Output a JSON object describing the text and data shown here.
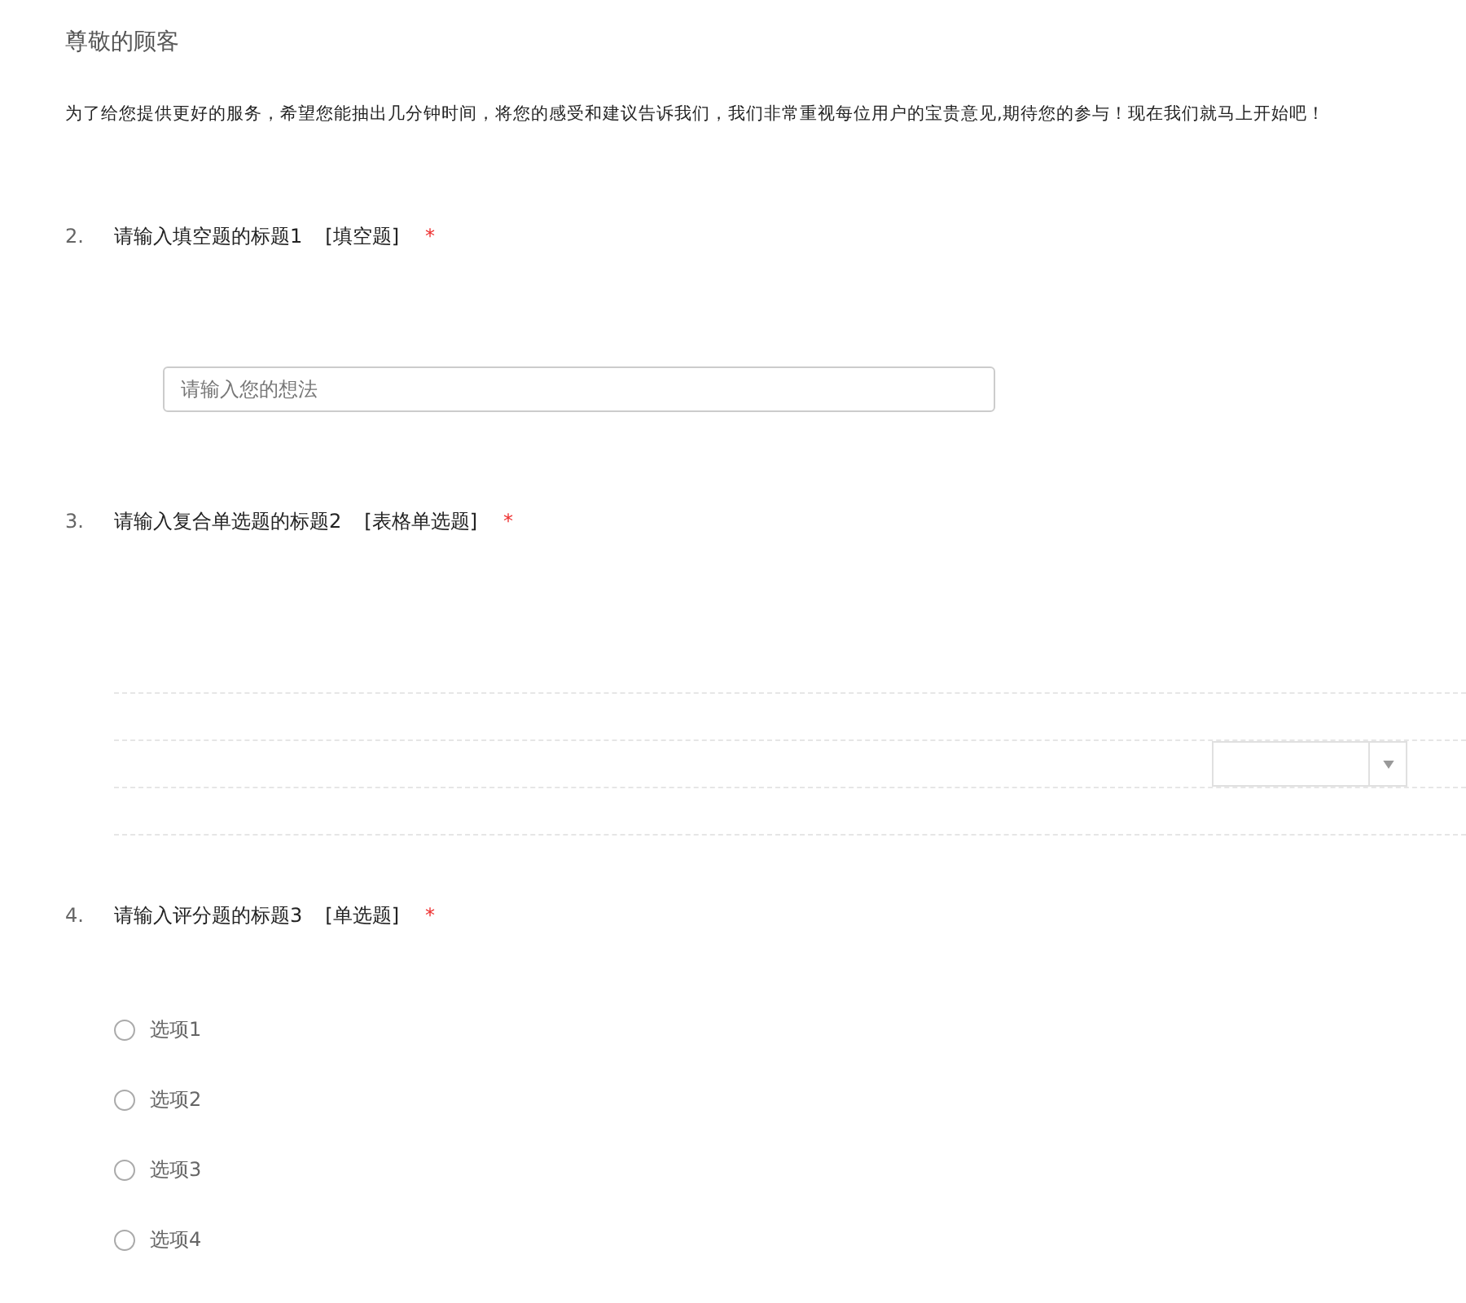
{
  "header": {
    "title": "尊敬的顾客",
    "intro": "为了给您提供更好的服务，希望您能抽出几分钟时间，将您的感受和建议告诉我们，我们非常重视每位用户的宝贵意见,期待您的参与！现在我们就马上开始吧！"
  },
  "questions": [
    {
      "kind": "text",
      "number": "2.",
      "title": "请输入填空题的标题1",
      "type_label": "[填空题]",
      "required_mark": "*",
      "placeholder": "请输入您的想法"
    },
    {
      "kind": "matrix",
      "number": "3.",
      "title": "请输入复合单选题的标题2",
      "type_label": "[表格单选题]",
      "required_mark": "*"
    },
    {
      "kind": "radio",
      "number": "4.",
      "title": "请输入评分题的标题3",
      "type_label": "[单选题]",
      "required_mark": "*",
      "options": [
        {
          "label": "选项1",
          "selected": false
        },
        {
          "label": "选项2",
          "selected": false
        },
        {
          "label": "选项3",
          "selected": false
        },
        {
          "label": "选项4",
          "selected": false
        }
      ]
    }
  ]
}
